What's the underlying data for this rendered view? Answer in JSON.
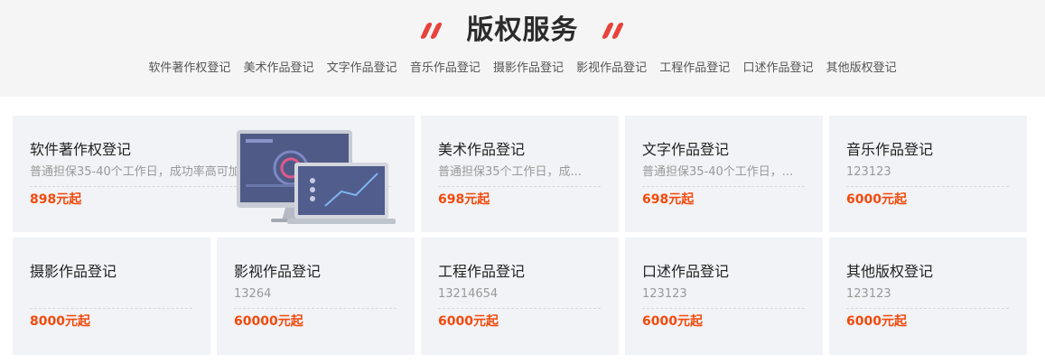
{
  "header": {
    "title": "版权服务",
    "nav": [
      "软件著作权登记",
      "美术作品登记",
      "文字作品登记",
      "音乐作品登记",
      "摄影作品登记",
      "影视作品登记",
      "工程作品登记",
      "口述作品登记",
      "其他版权登记"
    ]
  },
  "cards": [
    {
      "name": "软件著作权登记",
      "desc": "普通担保35-40个工作日，成功率高可加急，版权局审批，专业...",
      "price": "898元起"
    },
    {
      "name": "美术作品登记",
      "desc": "普通担保35个工作日，成...",
      "price": "698元起"
    },
    {
      "name": "文字作品登记",
      "desc": "普通担保35-40个工作日，...",
      "price": "698元起"
    },
    {
      "name": "音乐作品登记",
      "desc": "123123",
      "price": "6000元起"
    },
    {
      "name": "摄影作品登记",
      "desc": "",
      "price": "8000元起"
    },
    {
      "name": "影视作品登记",
      "desc": "13264",
      "price": "60000元起"
    },
    {
      "name": "工程作品登记",
      "desc": "13214654",
      "price": "6000元起"
    },
    {
      "name": "口述作品登记",
      "desc": "123123",
      "price": "6000元起"
    },
    {
      "name": "其他版权登记",
      "desc": "123123",
      "price": "6000元起"
    }
  ],
  "colors": {
    "accent": "#e8423c",
    "price": "#f24a0c",
    "card_bg": "#f2f3f6"
  },
  "icons": [
    "laptop-monitor-illustration"
  ]
}
